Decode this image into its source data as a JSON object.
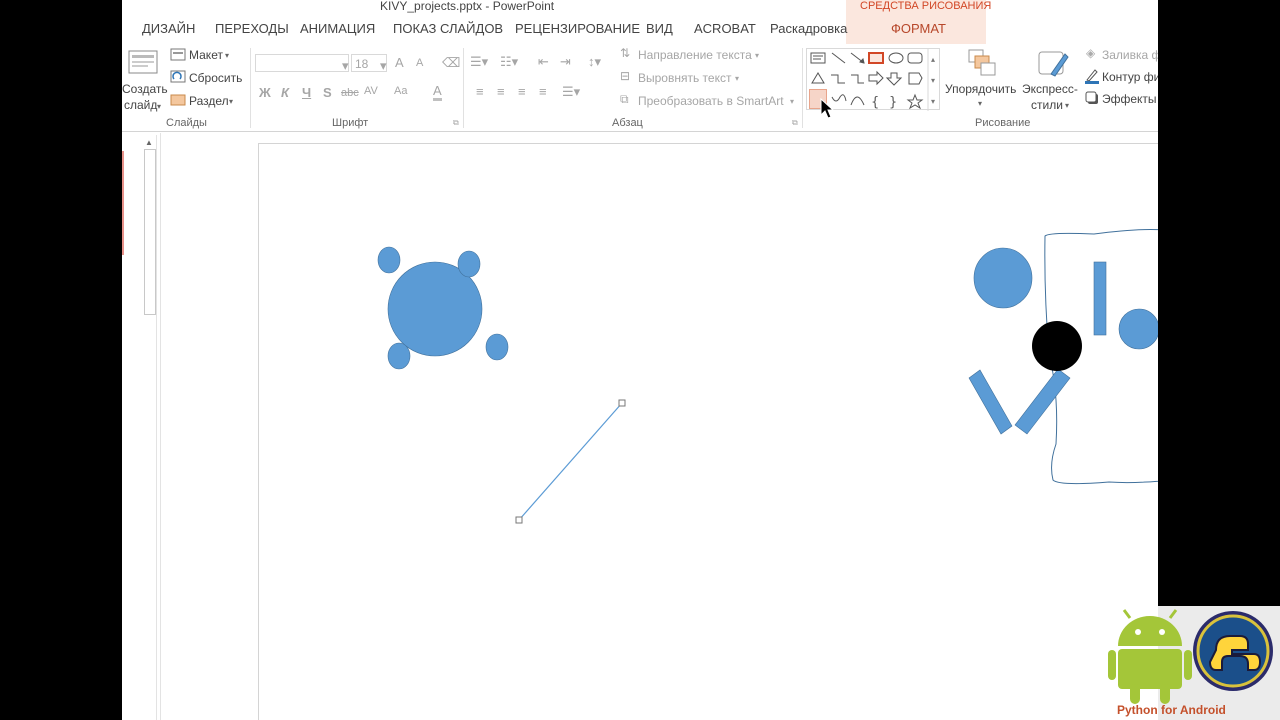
{
  "window": {
    "title": "KIVY_projects.pptx - PowerPoint",
    "context_group": "СРЕДСТВА РИСОВАНИЯ"
  },
  "tabs": [
    {
      "label": "ДИЗАЙН"
    },
    {
      "label": "ПЕРЕХОДЫ"
    },
    {
      "label": "АНИМАЦИЯ"
    },
    {
      "label": "ПОКАЗ СЛАЙДОВ"
    },
    {
      "label": "РЕЦЕНЗИРОВАНИЕ"
    },
    {
      "label": "ВИД"
    },
    {
      "label": "ACROBAT"
    },
    {
      "label": "Раскадровка"
    },
    {
      "label": "ФОРМАТ"
    }
  ],
  "ribbon": {
    "slides": {
      "create_line1": "Создать",
      "create_line2": "слайд",
      "layout": "Макет",
      "reset": "Сбросить",
      "section": "Раздел",
      "group_label": "Слайды"
    },
    "font": {
      "font_size": "18",
      "bold": "Ж",
      "italic": "К",
      "underline": "Ч",
      "shadow": "S",
      "strike": "abc",
      "spacing": "AV",
      "case": "Aa",
      "grow": "A",
      "shrink": "A",
      "color": "A",
      "group_label": "Шрифт"
    },
    "paragraph": {
      "text_direction": "Направление текста",
      "align_text": "Выровнять текст",
      "smartart": "Преобразовать в SmartArt",
      "group_label": "Абзац"
    },
    "drawing": {
      "arrange_line1": "Упорядочить",
      "quick_styles_line1": "Экспресс-",
      "quick_styles_line2": "стили",
      "fill": "Заливка ф",
      "outline": "Контур фи",
      "effects": "Эффекты ф",
      "group_label": "Рисование"
    }
  },
  "colors": {
    "shape_blue": "#5b9bd5",
    "shape_outline": "#41719c",
    "accent_orange": "#d24726",
    "black_circle": "#000000"
  },
  "watermark": {
    "text": "Python for Android"
  }
}
